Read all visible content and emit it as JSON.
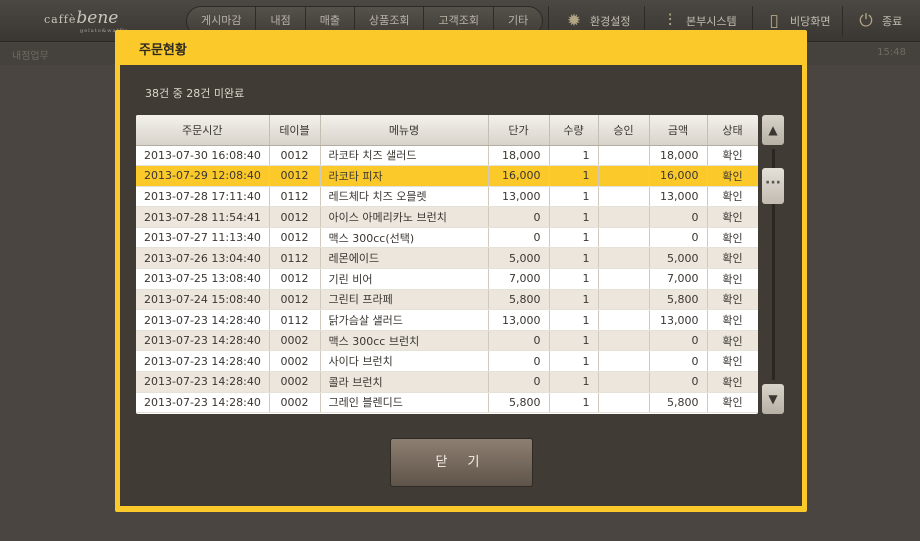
{
  "header": {
    "logo_main": "bene",
    "logo_prefix": "caffè",
    "logo_sub": "gelato&waffle",
    "menu": [
      "게시마감",
      "내점",
      "매출",
      "상품조회",
      "고객조회",
      "기타"
    ],
    "tools": [
      {
        "label": "환경설정",
        "icon": "gear-icon"
      },
      {
        "label": "본부시스템",
        "icon": "sliders-icon"
      },
      {
        "label": "비당화면",
        "icon": "tablet-icon"
      },
      {
        "label": "종료",
        "icon": "power-icon"
      }
    ]
  },
  "subbar": {
    "left": "내점업무",
    "time": "15:48"
  },
  "dialog": {
    "title": "주문현황",
    "summary": "38건 중 28건 미완료",
    "columns": [
      "주문시간",
      "테이블",
      "메뉴명",
      "단가",
      "수량",
      "승인",
      "금액",
      "상태"
    ],
    "rows": [
      [
        "2013-07-30 16:08:40",
        "0012",
        "라코타 치즈 샐러드",
        "18,000",
        "1",
        "",
        "18,000",
        "확인"
      ],
      [
        "2013-07-29 12:08:40",
        "0012",
        "라코타 피자",
        "16,000",
        "1",
        "",
        "16,000",
        "확인"
      ],
      [
        "2013-07-28 17:11:40",
        "0112",
        "레드체다 치즈 오믈렛",
        "13,000",
        "1",
        "",
        "13,000",
        "확인"
      ],
      [
        "2013-07-28 11:54:41",
        "0012",
        "아이스 아메리카노 브런치",
        "0",
        "1",
        "",
        "0",
        "확인"
      ],
      [
        "2013-07-27 11:13:40",
        "0012",
        "맥스 300cc(선택)",
        "0",
        "1",
        "",
        "0",
        "확인"
      ],
      [
        "2013-07-26 13:04:40",
        "0112",
        "레몬에이드",
        "5,000",
        "1",
        "",
        "5,000",
        "확인"
      ],
      [
        "2013-07-25 13:08:40",
        "0012",
        "기린 비어",
        "7,000",
        "1",
        "",
        "7,000",
        "확인"
      ],
      [
        "2013-07-24 15:08:40",
        "0012",
        "그린티 프라페",
        "5,800",
        "1",
        "",
        "5,800",
        "확인"
      ],
      [
        "2013-07-23 14:28:40",
        "0112",
        "닭가슴살 샐러드",
        "13,000",
        "1",
        "",
        "13,000",
        "확인"
      ],
      [
        "2013-07-23 14:28:40",
        "0002",
        "맥스 300cc 브런치",
        "0",
        "1",
        "",
        "0",
        "확인"
      ],
      [
        "2013-07-23 14:28:40",
        "0002",
        "사이다 브런치",
        "0",
        "1",
        "",
        "0",
        "확인"
      ],
      [
        "2013-07-23 14:28:40",
        "0002",
        "콜라 브런치",
        "0",
        "1",
        "",
        "0",
        "확인"
      ],
      [
        "2013-07-23 14:28:40",
        "0002",
        "그레인 블렌디드",
        "5,800",
        "1",
        "",
        "5,800",
        "확인"
      ]
    ],
    "selected_row": 1,
    "close_label": "닫 기"
  },
  "colors": {
    "accent": "#fbc92a",
    "panel": "#403b34"
  }
}
